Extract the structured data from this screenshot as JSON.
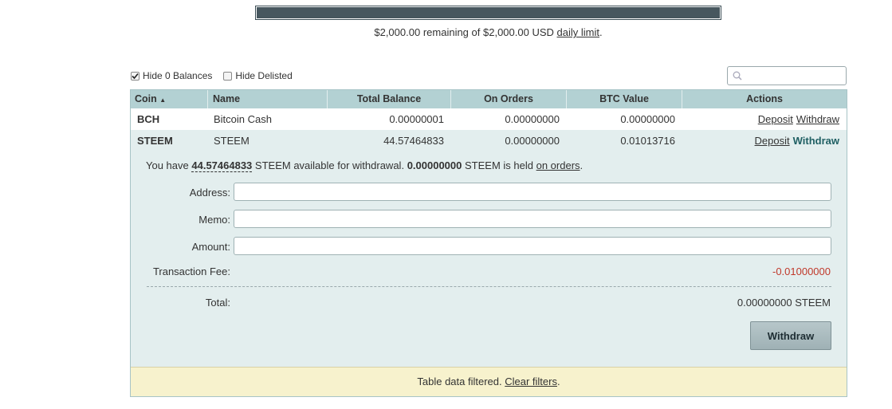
{
  "limit": {
    "fill_fraction": 1.0,
    "remaining": "$2,000.00",
    "text_mid": "remaining of",
    "total": "$2,000.00 USD",
    "link": "daily limit",
    "period": "."
  },
  "filters": {
    "hide_zero": {
      "label": "Hide 0 Balances",
      "checked": true
    },
    "hide_delisted": {
      "label": "Hide Delisted",
      "checked": false
    }
  },
  "search": {
    "placeholder": "",
    "icon": "search-icon"
  },
  "table": {
    "headers": {
      "coin": "Coin",
      "sort_indicator": "▲",
      "name": "Name",
      "total": "Total Balance",
      "orders": "On Orders",
      "btc": "BTC Value",
      "actions": "Actions"
    },
    "rows": [
      {
        "coin": "BCH",
        "name": "Bitcoin Cash",
        "total": "0.00000001",
        "orders": "0.00000000",
        "btc": "0.00000000",
        "deposit": "Deposit",
        "withdraw": "Withdraw"
      },
      {
        "coin": "STEEM",
        "name": "STEEM",
        "total": "44.57464833",
        "orders": "0.00000000",
        "btc": "0.01013716",
        "deposit": "Deposit",
        "withdraw": "Withdraw"
      }
    ]
  },
  "withdraw_panel": {
    "prefix": "You have",
    "amount": "44.57464833",
    "mid": "STEEM available for withdrawal.",
    "held": "0.00000000",
    "held_text": "STEEM is held",
    "orders_link": "on orders",
    "period": ".",
    "address_label": "Address:",
    "memo_label": "Memo:",
    "amount_label": "Amount:",
    "fee_label": "Transaction Fee:",
    "fee_value": "-0.01000000",
    "total_label": "Total:",
    "total_value": "0.00000000 STEEM",
    "button": "Withdraw"
  },
  "notice": {
    "text": "Table data filtered.",
    "link": "Clear filters",
    "period": "."
  }
}
